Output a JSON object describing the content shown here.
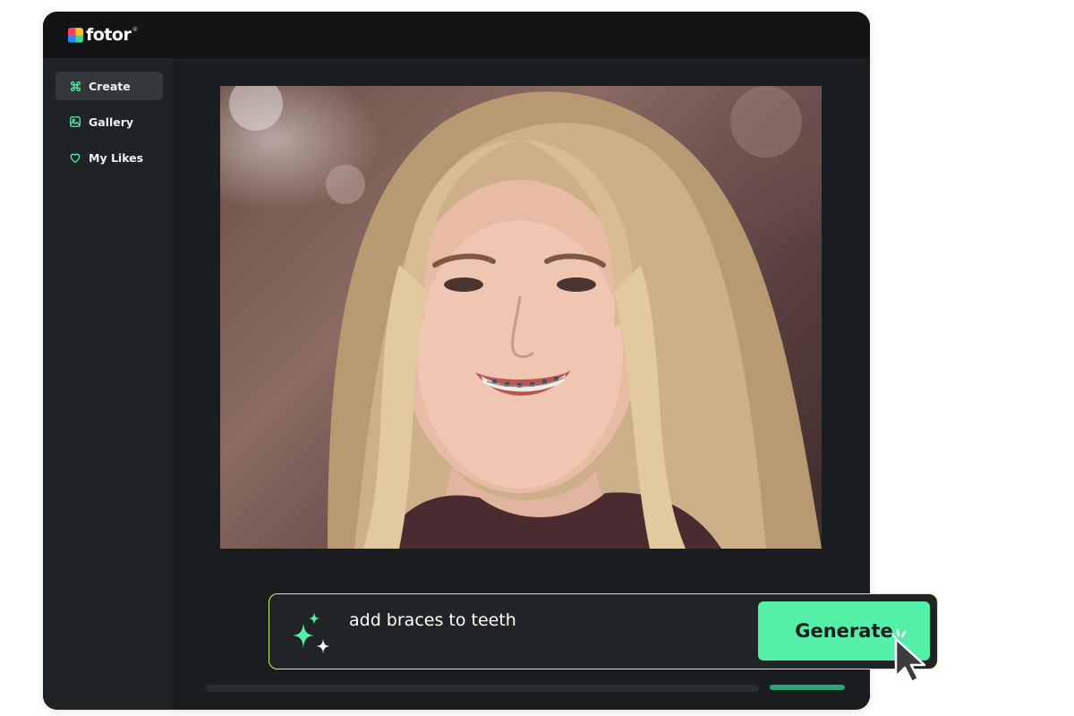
{
  "app": {
    "logo_text": "fotor",
    "logo_reg": "®"
  },
  "sidebar": {
    "items": [
      {
        "label": "Create",
        "icon": "command-icon",
        "active": true
      },
      {
        "label": "Gallery",
        "icon": "image-icon",
        "active": false
      },
      {
        "label": "My Likes",
        "icon": "heart-icon",
        "active": false
      }
    ]
  },
  "prompt": {
    "text": "add braces to teeth",
    "generate_label": "Generate"
  },
  "colors": {
    "accent": "#54f0a8",
    "prompt_border": "#d5f06a",
    "sidebar_icon": "#54f0a8"
  }
}
